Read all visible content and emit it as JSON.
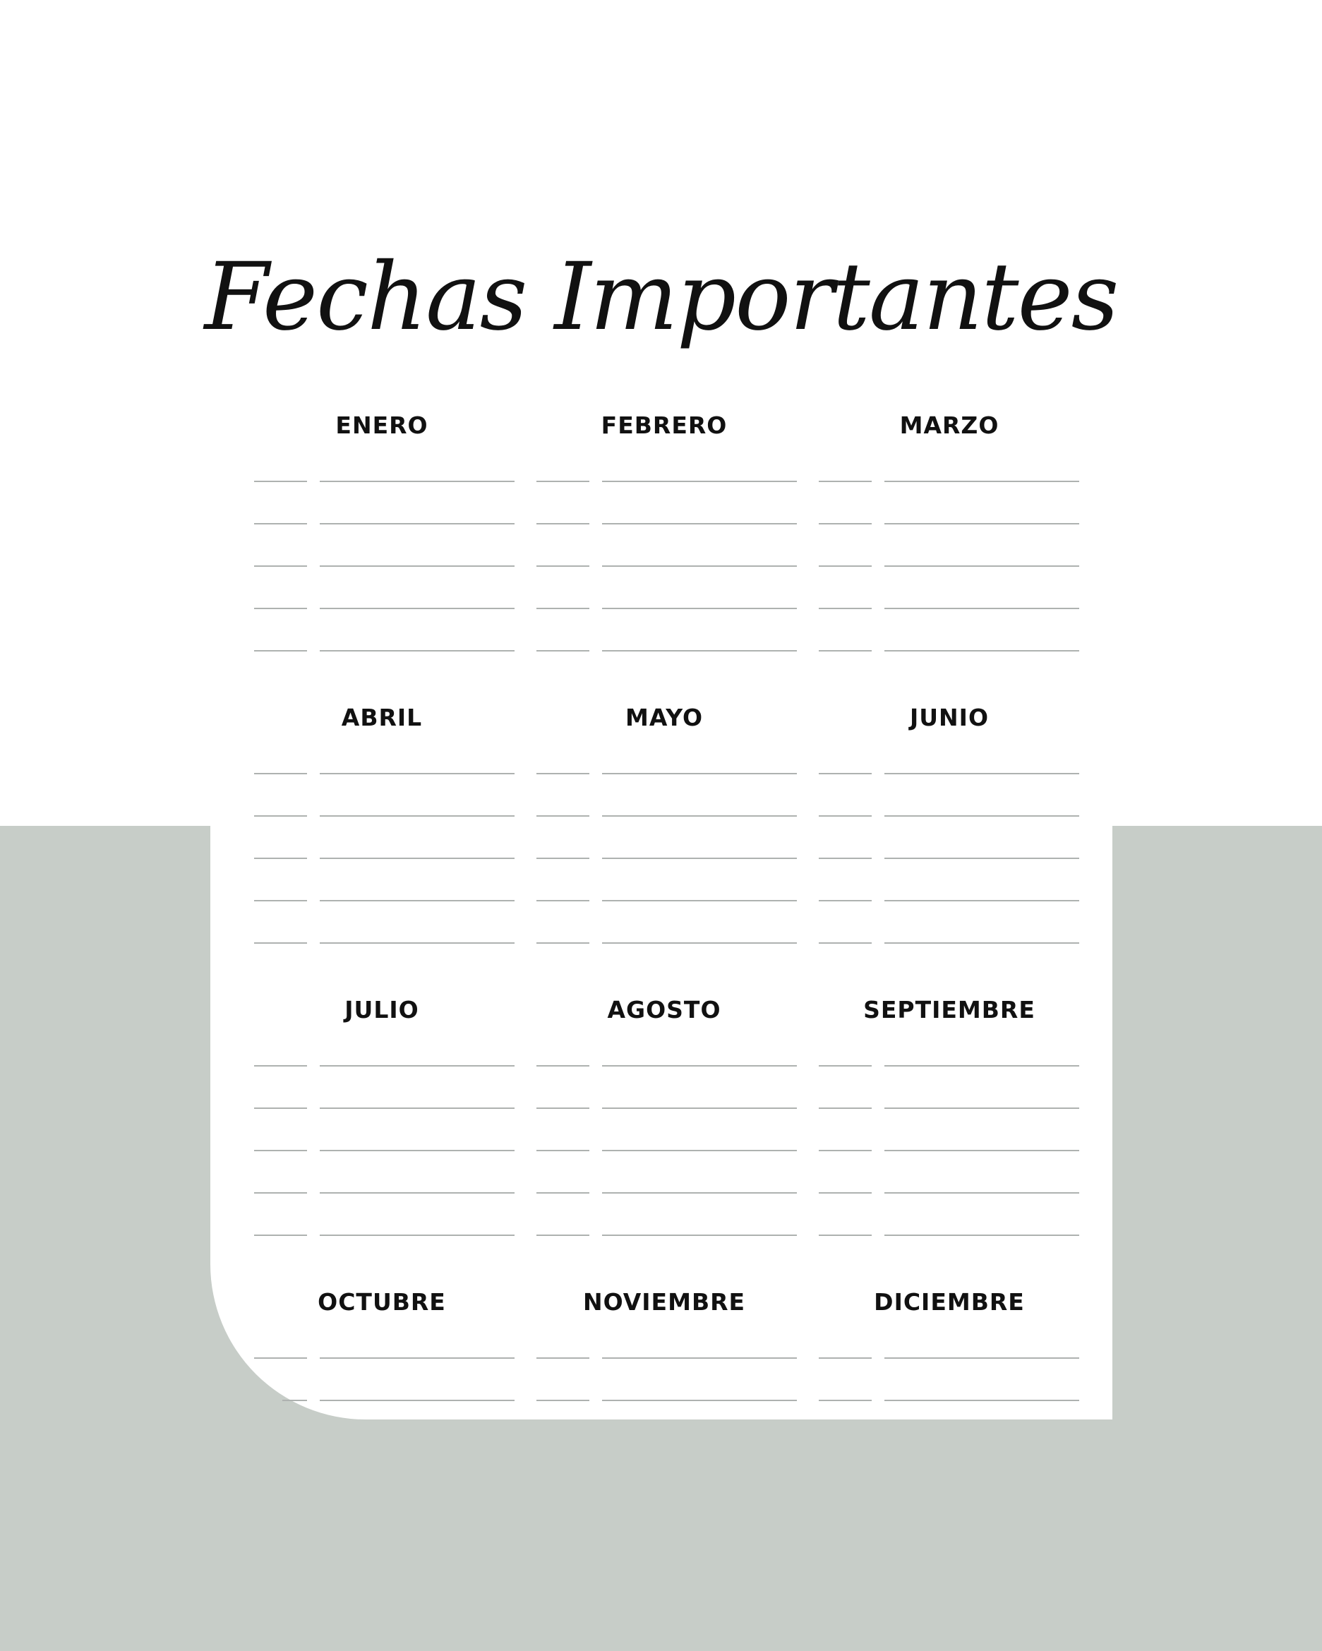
{
  "title": "Fechas Importantes",
  "colors": {
    "background_band": "#c7cdc8",
    "sheet": "#ffffff",
    "lines": "#aeb2b0",
    "text": "#111111"
  },
  "months": [
    {
      "name": "ENERO"
    },
    {
      "name": "FEBRERO"
    },
    {
      "name": "MARZO"
    },
    {
      "name": "ABRIL"
    },
    {
      "name": "MAYO"
    },
    {
      "name": "JUNIO"
    },
    {
      "name": "JULIO"
    },
    {
      "name": "AGOSTO"
    },
    {
      "name": "SEPTIEMBRE"
    },
    {
      "name": "OCTUBRE"
    },
    {
      "name": "NOVIEMBRE"
    },
    {
      "name": "DICIEMBRE"
    }
  ]
}
